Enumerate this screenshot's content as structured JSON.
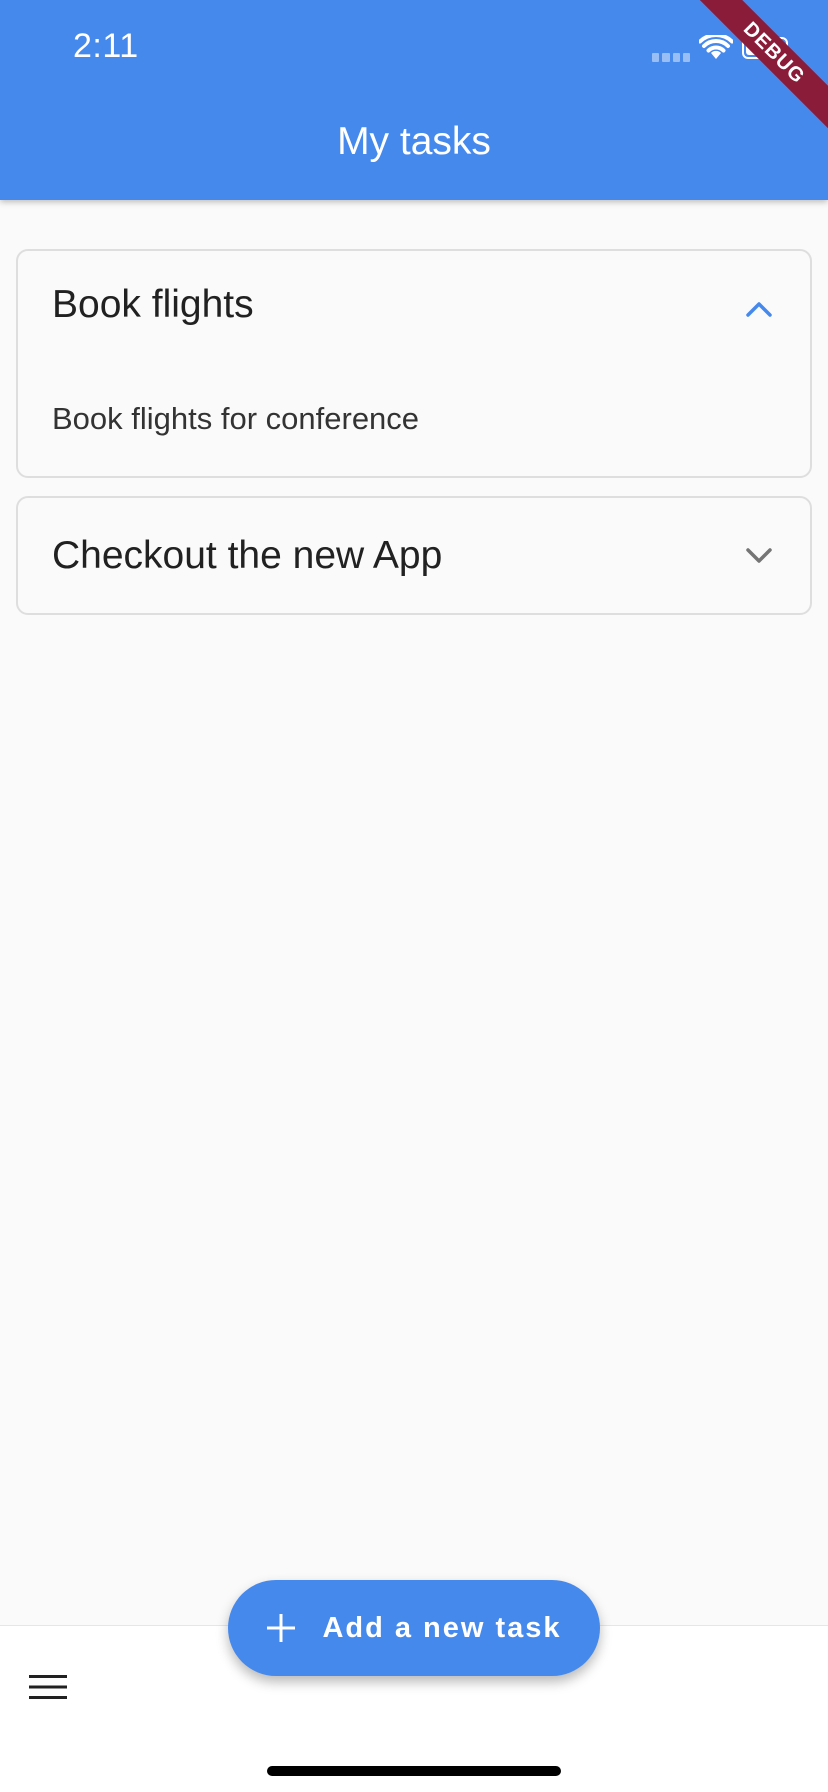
{
  "status_bar": {
    "time": "2:11"
  },
  "app_bar": {
    "title": "My tasks",
    "background": "#4689ed"
  },
  "debug_banner": {
    "label": "DEBUG",
    "color": "#8a1c3a"
  },
  "tasks": [
    {
      "title": "Book flights",
      "description": "Book flights for conference",
      "expanded": true,
      "chevron_icon": "chevron-up-icon",
      "chevron_color": "#4689ed"
    },
    {
      "title": "Checkout the new App",
      "expanded": false,
      "chevron_icon": "chevron-down-icon",
      "chevron_color": "#757575"
    }
  ],
  "fab": {
    "label": "Add a new task",
    "icon": "plus-icon"
  },
  "bottom_bar": {
    "menu_icon": "hamburger-menu-icon"
  }
}
